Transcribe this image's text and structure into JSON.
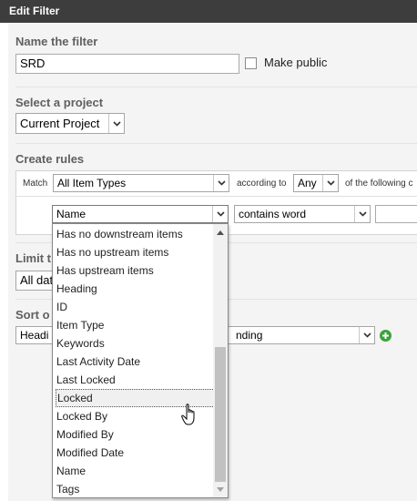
{
  "dialog": {
    "title": "Edit Filter"
  },
  "name_section": {
    "label": "Name the filter",
    "value": "SRD",
    "make_public_label": "Make public"
  },
  "project_section": {
    "label": "Select a project",
    "selected": "Current Project"
  },
  "rules_section": {
    "label": "Create rules",
    "match_label": "Match",
    "item_types_selected": "All Item Types",
    "according_to_label": "according to",
    "any_selected": "Any",
    "following_text": "of the following c",
    "field_selected": "Name",
    "operator_selected": "contains word"
  },
  "limit_section": {
    "label_partial": "Limit t",
    "value_partial": "All dat"
  },
  "sort_section": {
    "label_partial": "Sort o",
    "value_partial": "Headi",
    "order_partial": "nding"
  },
  "field_dropdown": {
    "options": [
      "Has no downstream items",
      "Has no upstream items",
      "Has upstream items",
      "Heading",
      "ID",
      "Item Type",
      "Keywords",
      "Last Activity Date",
      "Last Locked",
      "Locked",
      "Locked By",
      "Modified By",
      "Modified Date",
      "Name",
      "Tags"
    ],
    "hovered": "Locked"
  }
}
